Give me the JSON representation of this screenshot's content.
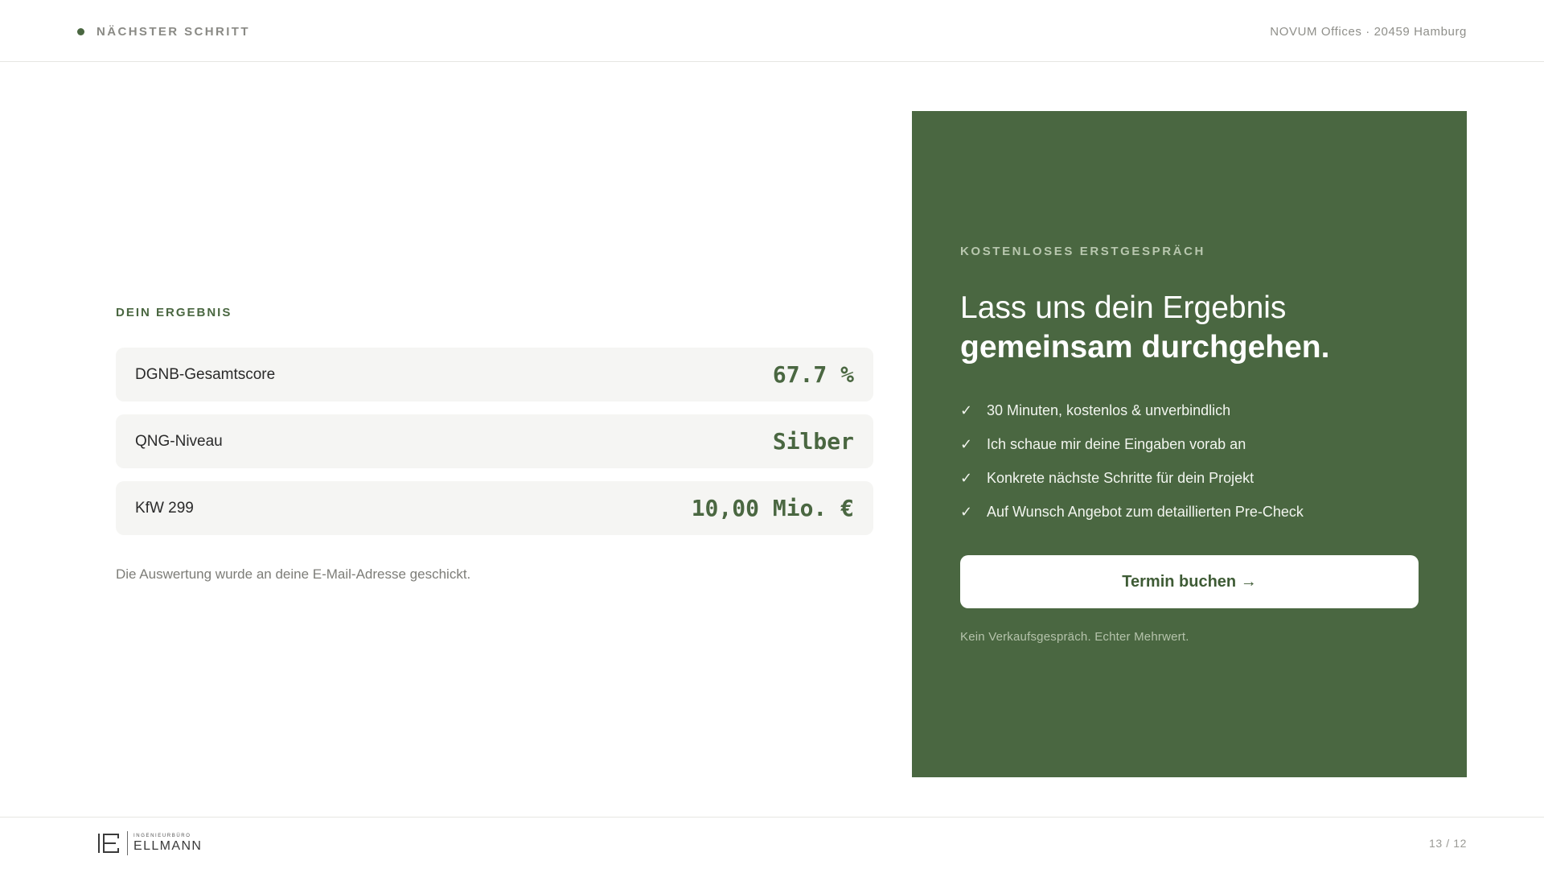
{
  "header": {
    "step_label": "NÄCHSTER SCHRITT",
    "location": "NOVUM Offices · 20459 Hamburg"
  },
  "results": {
    "section_label": "DEIN ERGEBNIS",
    "items": [
      {
        "label": "DGNB-Gesamtscore",
        "value": "67.7 %"
      },
      {
        "label": "QNG-Niveau",
        "value": "Silber"
      },
      {
        "label": "KfW 299",
        "value": "10,00 Mio. €"
      }
    ],
    "note": "Die Auswertung wurde an deine E-Mail-Adresse geschickt."
  },
  "cta": {
    "kicker": "KOSTENLOSES ERSTGESPRÄCH",
    "title_light": "Lass uns dein Ergebnis",
    "title_bold": "gemeinsam durchgehen.",
    "bullet_icon": "checkmark-icon",
    "bullets": [
      "30 Minuten, kostenlos & unverbindlich",
      "Ich schaue mir deine Eingaben vorab an",
      "Konkrete nächste Schritte für dein Projekt",
      "Auf Wunsch Angebot zum detaillierten Pre-Check"
    ],
    "button_label": "Termin buchen →",
    "note": "Kein Verkaufsgespräch. Echter Mehrwert."
  },
  "footer": {
    "logo_sub": "INGENIEURBÜRO",
    "logo_main": "ELLMANN",
    "page_number": "13 / 12"
  },
  "colors": {
    "accent": "#4a6741",
    "card_background": "#f5f5f3",
    "text_muted": "#8a8a85"
  }
}
